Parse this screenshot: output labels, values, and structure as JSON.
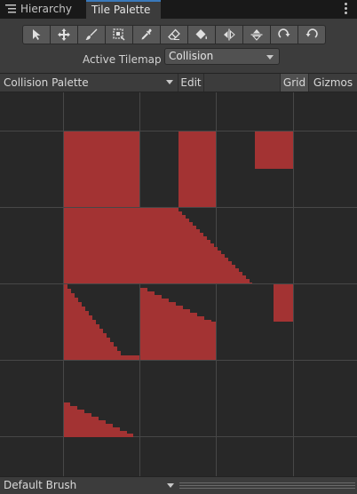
{
  "tabs": {
    "hierarchy": {
      "label": "Hierarchy",
      "icon": "list-icon"
    },
    "tile_palette": {
      "label": "Tile Palette",
      "active": true
    }
  },
  "toolbar": {
    "tools": [
      {
        "name": "select-tool",
        "icon": "arrow-icon"
      },
      {
        "name": "move-tool",
        "icon": "move-icon"
      },
      {
        "name": "paint-tool",
        "icon": "brush-icon"
      },
      {
        "name": "box-fill-tool",
        "icon": "box-fill-icon"
      },
      {
        "name": "pick-tool",
        "icon": "eyedropper-icon"
      },
      {
        "name": "erase-tool",
        "icon": "eraser-icon"
      },
      {
        "name": "fill-tool",
        "icon": "bucket-icon"
      },
      {
        "name": "flip-x-tool",
        "icon": "flip-horizontal-icon"
      },
      {
        "name": "flip-y-tool",
        "icon": "flip-vertical-icon"
      },
      {
        "name": "rotate-cw-tool",
        "icon": "rotate-cw-icon"
      },
      {
        "name": "rotate-ccw-tool",
        "icon": "rotate-ccw-icon"
      }
    ],
    "active_tilemap_label": "Active Tilemap",
    "active_tilemap_value": "Collision"
  },
  "palette_bar": {
    "palette_value": "Collision Palette",
    "edit_label": "Edit",
    "grid_label": "Grid",
    "gizmos_label": "Gizmos"
  },
  "status": {
    "brush_value": "Default Brush"
  },
  "colors": {
    "tile": "#a33333",
    "grid_line": "#474747",
    "accent": "#3a79bb"
  }
}
